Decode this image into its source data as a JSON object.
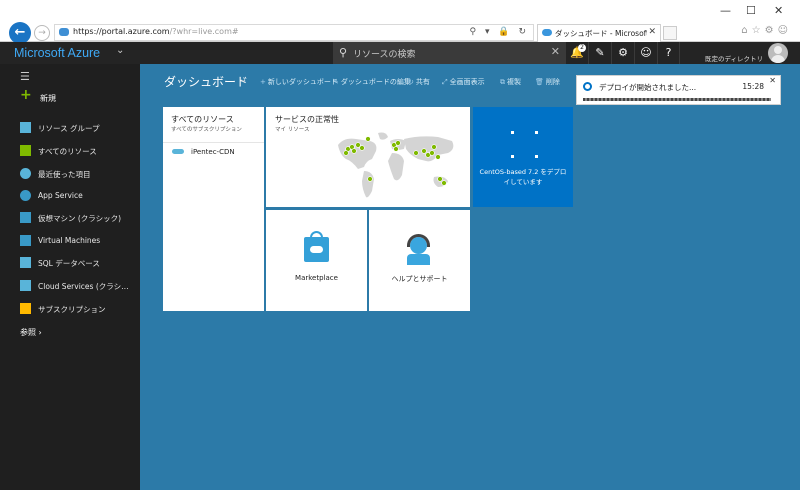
{
  "browser": {
    "url_host": "https://portal.azure.com",
    "url_path": "/?whr=live.com#",
    "tab_title": "ダッシュボード - Microsoft Azure",
    "url_actions": "⚲ ▾ 🔒 ↻",
    "close_glyph": "✕",
    "minimize_glyph": "—",
    "maximize_glyph": "☐"
  },
  "header": {
    "brand": "Microsoft Azure",
    "search_placeholder": "リソースの検索",
    "notification_count": "2",
    "directory": "既定のディレクトリ"
  },
  "sidebar": {
    "new_label": "新規",
    "items": [
      {
        "label": "リソース グループ",
        "color": "#59b4d9"
      },
      {
        "label": "すべてのリソース",
        "color": "#7fba00"
      },
      {
        "label": "最近使った項目",
        "color": "#59b4d9"
      },
      {
        "label": "App Service",
        "color": "#3999c6"
      },
      {
        "label": "仮想マシン (クラシック)",
        "color": "#3999c6"
      },
      {
        "label": "Virtual Machines",
        "color": "#3999c6"
      },
      {
        "label": "SQL データベース",
        "color": "#59b4d9"
      },
      {
        "label": "Cloud Services (クラシック)",
        "color": "#59b4d9"
      },
      {
        "label": "サブスクリプション",
        "color": "#ffb900"
      }
    ],
    "browse_label": "参照"
  },
  "dashboard": {
    "title": "ダッシュボード",
    "toolbar": [
      {
        "icon": "+",
        "label": "新しいダッシュボード"
      },
      {
        "icon": "✎",
        "label": "ダッシュボードの編集"
      },
      {
        "icon": "↻",
        "label": "共有"
      },
      {
        "icon": "⤢",
        "label": "全画面表示"
      },
      {
        "icon": "⧉",
        "label": "複製"
      },
      {
        "icon": "🗑",
        "label": "削除"
      }
    ],
    "tiles": {
      "all_resources": {
        "title": "すべてのリソース",
        "subtitle": "すべてのサブスクリプション",
        "items": [
          "iPentec-CDN"
        ]
      },
      "service_health": {
        "title": "サービスの正常性",
        "subtitle": "マイ リソース"
      },
      "deploying": {
        "text": "CentOS-based 7.2 をデプロイしています"
      },
      "marketplace": {
        "label": "Marketplace"
      },
      "help": {
        "label": "ヘルプとサポート"
      }
    }
  },
  "notification": {
    "text": "デプロイが開始されました...",
    "time": "15:28"
  }
}
